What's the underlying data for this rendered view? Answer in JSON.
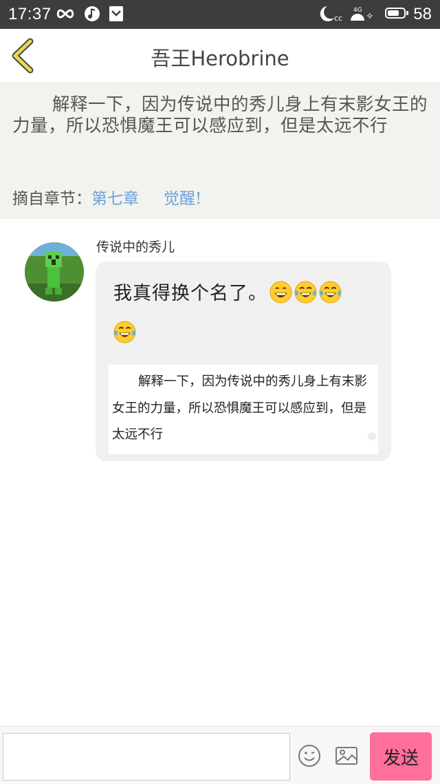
{
  "status_bar": {
    "time": "17:37",
    "battery_level": "58",
    "icons": [
      "infinity-icon",
      "music-icon",
      "download-icon",
      "moon-icon",
      "signal-4g-icon",
      "battery-icon"
    ]
  },
  "header": {
    "title": "吾王Herobrine"
  },
  "excerpt": {
    "text": "解释一下，因为传说中的秀儿身上有末影女王的力量，所以恐惧魔王可以感应到，但是太远不行",
    "source_label": "摘自章节：",
    "chapter": "第七章",
    "chapter_title": "觉醒!"
  },
  "comment": {
    "username": "传说中的秀儿",
    "text": "我真得换个名了。",
    "emojis": [
      "grinning-emoji",
      "tears-of-joy-emoji",
      "tears-of-joy-emoji",
      "tears-of-joy-emoji"
    ],
    "quote_image_text": "解释一下，因为传说中的秀儿身上有末影女王的力量，所以恐惧魔王可以感应到，但是太远不行"
  },
  "input_bar": {
    "input_value": "",
    "send_label": "发送"
  },
  "colors": {
    "status_bar_bg": "#3d3d3d",
    "excerpt_bg": "#f2f2ee",
    "link": "#6ea0d8",
    "send_button": "#ff6f9b",
    "back_arrow": "#e7d75a"
  }
}
